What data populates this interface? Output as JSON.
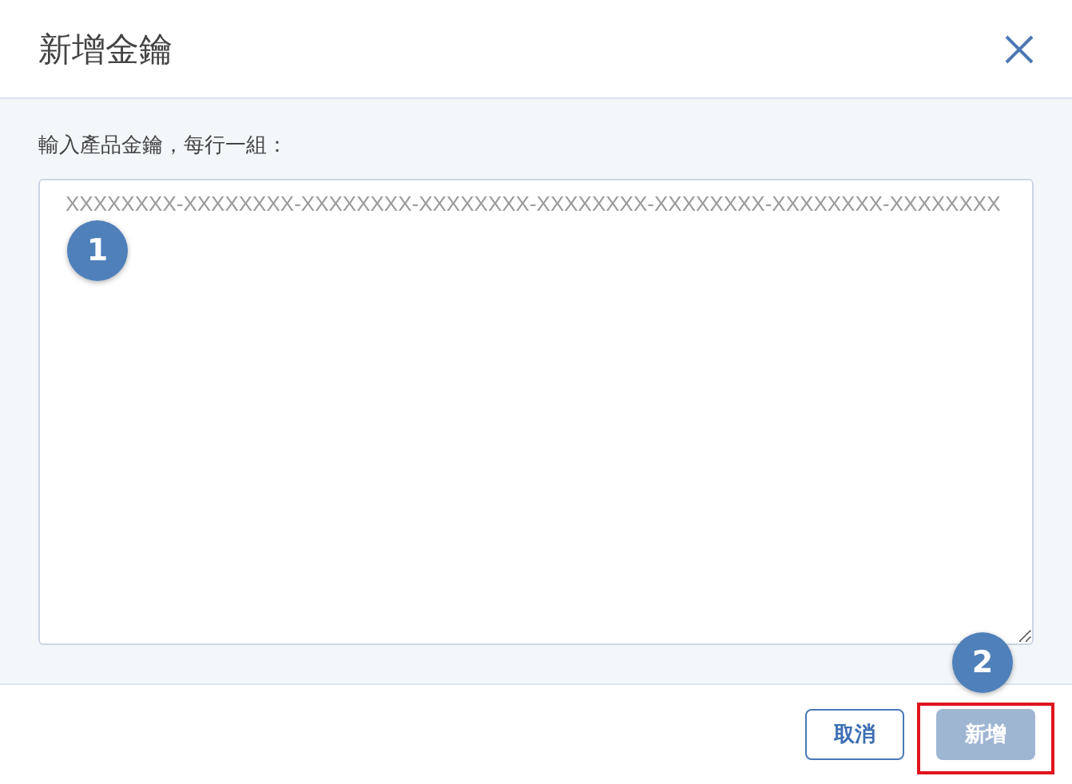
{
  "dialog": {
    "title": "新增金鑰"
  },
  "form": {
    "label": "輸入產品金鑰，每行一組：",
    "keys_field": {
      "placeholder": "XXXXXXXX-XXXXXXXX-XXXXXXXX-XXXXXXXX-XXXXXXXX-XXXXXXXX-XXXXXXXX-XXXXXXXX"
    }
  },
  "buttons": [
    {
      "label": "取消",
      "kind": "secondary",
      "disabled": false
    },
    {
      "label": "新增",
      "kind": "primary",
      "disabled": true
    }
  ],
  "callouts": [
    {
      "number": "1"
    },
    {
      "number": "2"
    }
  ]
}
